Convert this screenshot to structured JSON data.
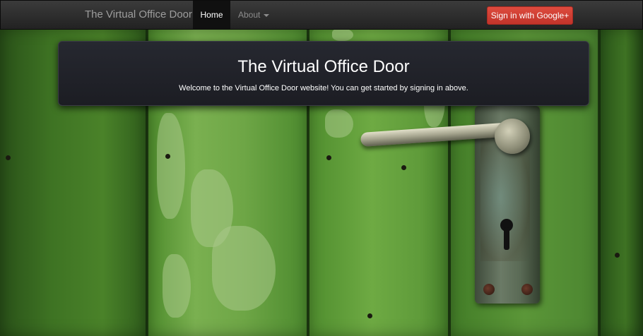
{
  "navbar": {
    "brand": "The Virtual Office Door",
    "items": [
      {
        "label": "Home",
        "active": true
      },
      {
        "label": "About",
        "dropdown": true
      }
    ],
    "signin_label": "Sign in with Google+",
    "signin_icon": "google-plus-icon"
  },
  "hero": {
    "title": "The Virtual Office Door",
    "text": "Welcome to the Virtual Office Door website! You can get started by signing in above."
  },
  "colors": {
    "navbar": "#222222",
    "active_tab": "#101010",
    "signin_button": "#d14836",
    "hero_panel": "#1f2026",
    "door_green": "#5a9a36"
  }
}
